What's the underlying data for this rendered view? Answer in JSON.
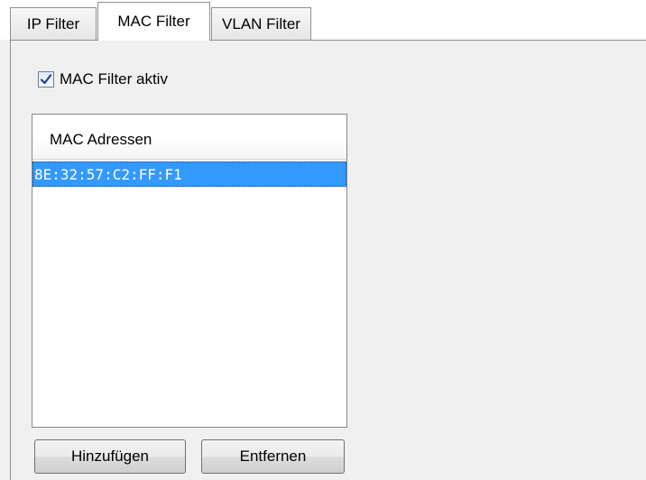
{
  "tabs": [
    {
      "label": "IP Filter",
      "active": false
    },
    {
      "label": "MAC Filter",
      "active": true
    },
    {
      "label": "VLAN Filter",
      "active": false
    }
  ],
  "mac_filter": {
    "enabled_label": "MAC Filter aktiv",
    "enabled": true,
    "list_header": "MAC Adressen",
    "addresses": [
      "8E:32:57:C2:FF:F1"
    ],
    "selected_index": 0,
    "add_button": "Hinzufügen",
    "remove_button": "Entfernen"
  },
  "colors": {
    "selection": "#3399ff",
    "selection_text": "#ffffff",
    "pane_background": "#f0f0f0"
  }
}
